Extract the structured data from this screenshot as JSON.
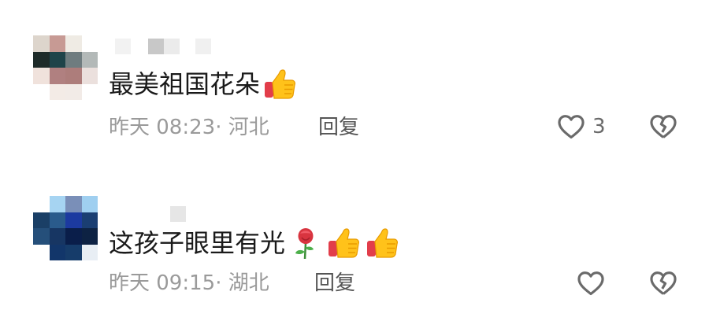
{
  "comments": [
    {
      "text": "最美祖国花朵",
      "time": "昨天 08:23",
      "location": "河北",
      "reply_label": "回复",
      "like_count": "3",
      "emojis": [
        "thumbs-up-emoji"
      ]
    },
    {
      "text": "这孩子眼里有光",
      "time": "昨天 09:15",
      "location": "湖北",
      "reply_label": "回复",
      "like_count": "",
      "emojis": [
        "rose-emoji",
        "thumbs-up-emoji",
        "thumbs-up-emoji"
      ]
    }
  ],
  "separator": "·",
  "colors": {
    "text": "#1a1a1a",
    "meta": "#9a9a9a",
    "reply": "#555555",
    "icon": "#6a6a6a"
  },
  "avatar_pixels": [
    [
      "#ddd5cc",
      "#c79a94",
      "#efebe4",
      "#ffffff",
      "#1e2b29",
      "#1f4349",
      "#6f7c7f",
      "#b3b9b8",
      "#f0e2dc",
      "#b08080",
      "#ad7d7b",
      "#ebe0dd",
      "#ffffff",
      "#f3ebe6",
      "#f2ebe7",
      "#ffffff"
    ],
    [
      "#ffffff",
      "#a6d4f2",
      "#7a8fb8",
      "#9fcff0",
      "#1a3f66",
      "#2a5b8c",
      "#1c3aa0",
      "#1a3e72",
      "#254f7a",
      "#173663",
      "#0a1e4a",
      "#0d2243",
      "#ffffff",
      "#12366a",
      "#163c6a",
      "#e8eef4"
    ]
  ],
  "username_pixels": [
    [
      "#f2f2f2",
      "#c8c8c8",
      "#ebebeb",
      "#f0f0f0"
    ],
    [
      "#e6e6e6"
    ]
  ]
}
